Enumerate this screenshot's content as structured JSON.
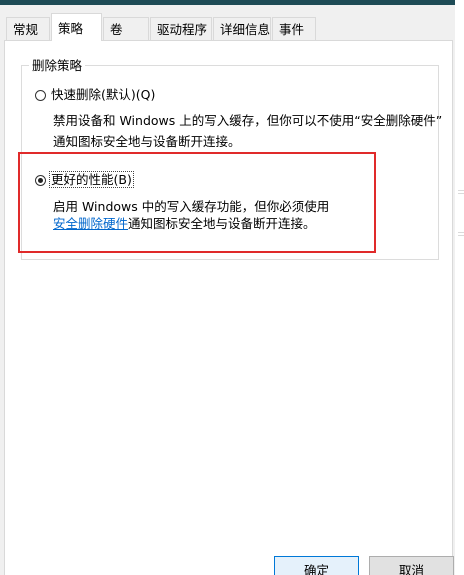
{
  "tabs": [
    {
      "label": "常规"
    },
    {
      "label": "策略"
    },
    {
      "label": "卷"
    },
    {
      "label": "驱动程序"
    },
    {
      "label": "详细信息"
    },
    {
      "label": "事件"
    }
  ],
  "active_tab_index": 1,
  "group": {
    "title": "删除策略"
  },
  "options": {
    "quick_removal": {
      "label": "快速删除(默认)(Q)",
      "selected": false,
      "desc_line1": "禁用设备和 Windows 上的写入缓存，但你可以不使用“安全删除硬件”",
      "desc_line2": "通知图标安全地与设备断开连接。"
    },
    "better_performance": {
      "label": "更好的性能(B)",
      "selected": true,
      "desc_line1": "启用 Windows 中的写入缓存功能，但你必须使用",
      "desc_link": "安全删除硬件",
      "desc_line2_rest": "通知图标安全地与设备断开连接。"
    }
  },
  "buttons": {
    "ok_label": "确定",
    "cancel_label": "取消"
  },
  "colors": {
    "highlight_border": "#e02a2a",
    "link": "#0066cc",
    "title_strip": "#1e4b56"
  }
}
